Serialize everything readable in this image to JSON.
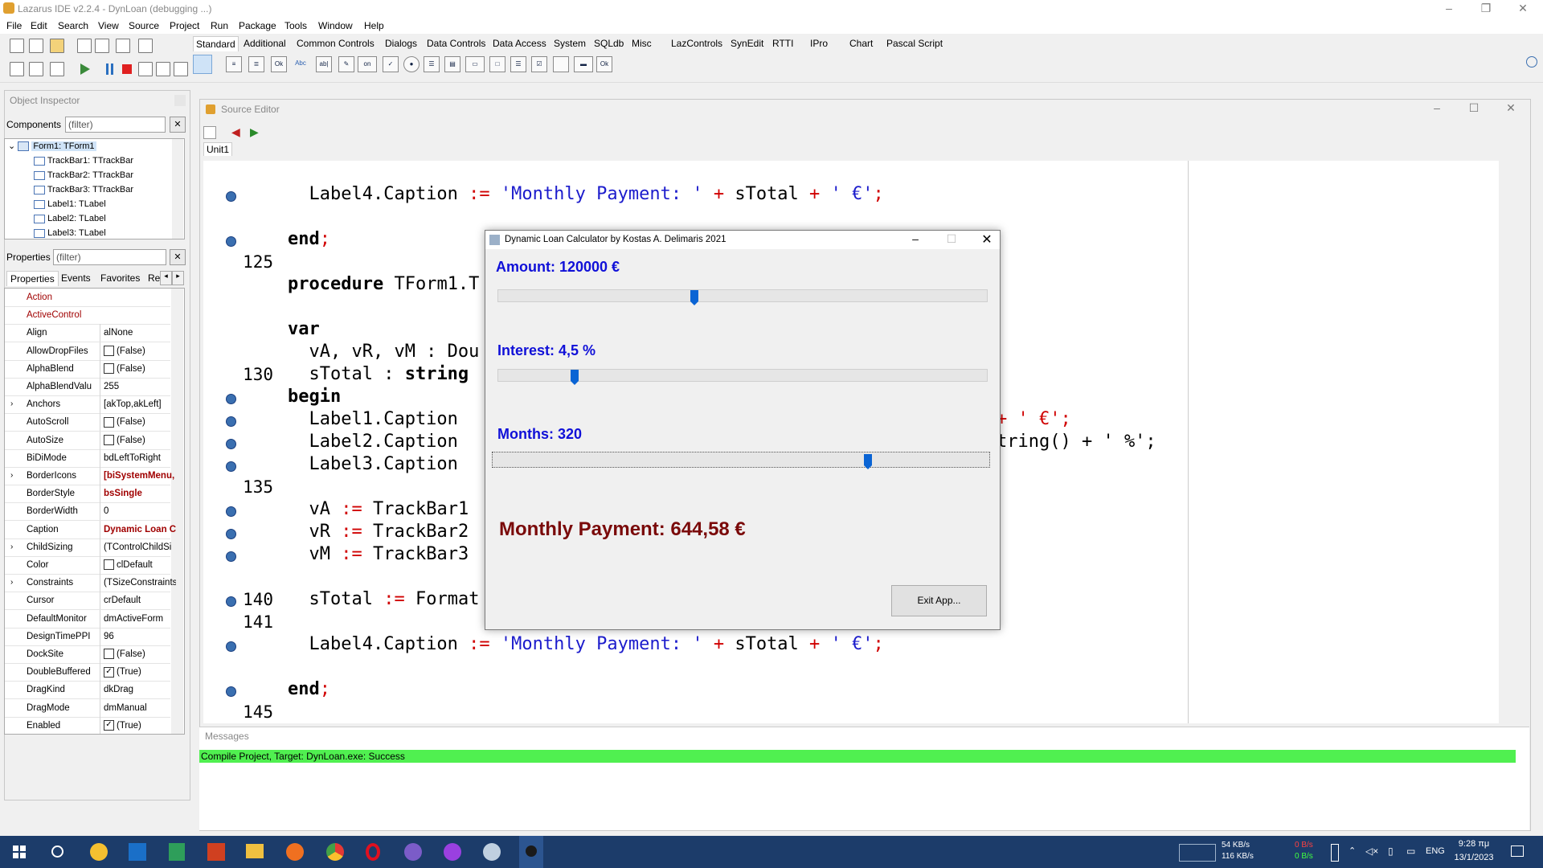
{
  "window": {
    "title": "Lazarus IDE v2.2.4 - DynLoan (debugging ...)"
  },
  "menu": [
    "File",
    "Edit",
    "Search",
    "View",
    "Source",
    "Project",
    "Run",
    "Package",
    "Tools",
    "Window",
    "Help"
  ],
  "palette_tabs": [
    "Standard",
    "Additional",
    "Common Controls",
    "Dialogs",
    "Data Controls",
    "Data Access",
    "System",
    "SQLdb",
    "Misc",
    "LazControls",
    "SynEdit",
    "RTTI",
    "IPro",
    "Chart",
    "Pascal Script"
  ],
  "object_inspector": {
    "title": "Object Inspector",
    "components_label": "Components",
    "components_filter": "(filter)",
    "tree": [
      "Form1: TForm1",
      "TrackBar1: TTrackBar",
      "TrackBar2: TTrackBar",
      "TrackBar3: TTrackBar",
      "Label1: TLabel",
      "Label2: TLabel",
      "Label3: TLabel"
    ],
    "properties_label": "Properties",
    "properties_filter": "(filter)",
    "tabs": [
      "Properties",
      "Events",
      "Favorites",
      "Re"
    ],
    "rows": [
      {
        "name": "Action",
        "value": ""
      },
      {
        "name": "ActiveControl",
        "value": ""
      },
      {
        "name": "Align",
        "value": "alNone"
      },
      {
        "name": "AllowDropFiles",
        "value": "(False)"
      },
      {
        "name": "AlphaBlend",
        "value": "(False)"
      },
      {
        "name": "AlphaBlendValu",
        "value": "255"
      },
      {
        "name": "Anchors",
        "value": "[akTop,akLeft]"
      },
      {
        "name": "AutoScroll",
        "value": "(False)"
      },
      {
        "name": "AutoSize",
        "value": "(False)"
      },
      {
        "name": "BiDiMode",
        "value": "bdLeftToRight"
      },
      {
        "name": "BorderIcons",
        "value": "[biSystemMenu,"
      },
      {
        "name": "BorderStyle",
        "value": "bsSingle"
      },
      {
        "name": "BorderWidth",
        "value": "0"
      },
      {
        "name": "Caption",
        "value": "Dynamic Loan C"
      },
      {
        "name": "ChildSizing",
        "value": "(TControlChildSi"
      },
      {
        "name": "Color",
        "value": "clDefault"
      },
      {
        "name": "Constraints",
        "value": "(TSizeConstraints"
      },
      {
        "name": "Cursor",
        "value": "crDefault"
      },
      {
        "name": "DefaultMonitor",
        "value": "dmActiveForm"
      },
      {
        "name": "DesignTimePPI",
        "value": "96"
      },
      {
        "name": "DockSite",
        "value": "(False)"
      },
      {
        "name": "DoubleBuffered",
        "value": "(True)"
      },
      {
        "name": "DragKind",
        "value": "dkDrag"
      },
      {
        "name": "DragMode",
        "value": "dmManual"
      },
      {
        "name": "Enabled",
        "value": "(True)"
      }
    ]
  },
  "source_editor": {
    "title": "Source Editor",
    "tab": "Unit1",
    "line_numbers": {
      "l125": "125",
      "l130": "130",
      "l135": "135",
      "l140": "140",
      "l141": "141",
      "l145": "145"
    },
    "code": {
      "c1a": "  Label4.Caption ",
      "c1b": ":=",
      "c1c": " 'Monthly Payment: '",
      "c1d": " + ",
      "c1e": "sTotal",
      "c1f": " + ",
      "c1g": "' €'",
      "c1h": ";",
      "c2a": "end",
      "c2b": ";",
      "c3a": "procedure",
      "c3b": " TForm1.T",
      "c4": "var",
      "c5": "  vA, vR, vM : Dou",
      "c6a": "  sTotal : ",
      "c6b": "string",
      "c7": "begin",
      "c8": "  Label1.Caption",
      "c8b": "+ ' €';",
      "c9": "  Label2.Caption",
      "c9b": "tring() + ' %';",
      "c10": "  Label3.Caption",
      "c11a": "  vA ",
      "c11b": ":=",
      "c11c": " TrackBar1",
      "c12a": "  vR ",
      "c12b": ":=",
      "c12c": " TrackBar2",
      "c13a": "  vM ",
      "c13b": ":=",
      "c13c": " TrackBar3",
      "c14a": "  sTotal ",
      "c14b": ":=",
      "c14c": " Format",
      "c15a": "  Label4.Caption ",
      "c15b": ":=",
      "c15c": " 'Monthly Payment: '",
      "c15d": " + ",
      "c15e": "sTotal",
      "c15f": " + ",
      "c15g": "' €'",
      "c15h": ";",
      "c16a": "end",
      "c16b": ";"
    }
  },
  "messages": {
    "title": "Messages",
    "line": "Compile Project, Target: DynLoan.exe: Success"
  },
  "dialog": {
    "title": "Dynamic Loan Calculator by Kostas A. Delimaris 2021",
    "amount_label": "Amount: 120000 €",
    "amount_level": 0.4,
    "interest_label": "Interest: 4,5 %",
    "interest_level": 0.15,
    "months_label": "Months: 320",
    "months_level": 0.76,
    "payment_label": "Monthly Payment: 644,58 €",
    "exit_label": "Exit App..."
  },
  "taskbar": {
    "net_up": "54 KB/s",
    "net_down": "116 KB/s",
    "disk_r": "0 B/s",
    "disk_w": "0 B/s",
    "lang": "ENG",
    "time": "9:28 πμ",
    "date": "13/1/2023"
  }
}
